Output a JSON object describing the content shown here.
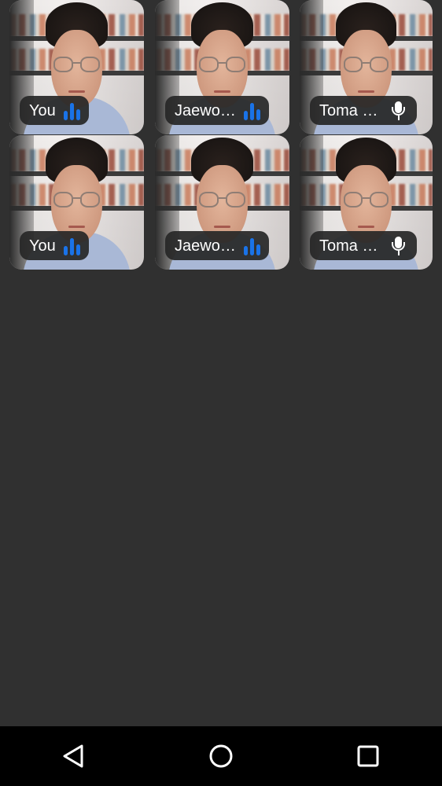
{
  "participants": [
    {
      "name": "You",
      "status_icon": "audio-level-icon"
    },
    {
      "name": "Jaewo…",
      "status_icon": "audio-level-icon"
    },
    {
      "name": "Toma …",
      "status_icon": "microphone-icon"
    },
    {
      "name": "You",
      "status_icon": "audio-level-icon"
    },
    {
      "name": "Jaewo…",
      "status_icon": "audio-level-icon"
    },
    {
      "name": "Toma …",
      "status_icon": "microphone-icon"
    }
  ],
  "colors": {
    "background": "#303030",
    "label_background": "#262626",
    "audio_level": "#1a73e8",
    "navbar": "#000000"
  },
  "navbar": {
    "back_icon": "back-triangle-icon",
    "home_icon": "home-circle-icon",
    "recents_icon": "recents-square-icon"
  }
}
